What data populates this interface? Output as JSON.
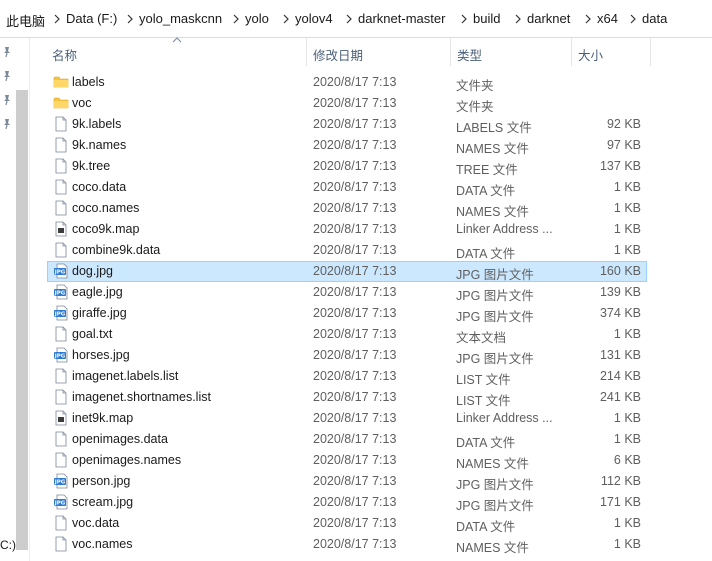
{
  "breadcrumb": [
    "此电脑",
    "Data (F:)",
    "yolo_maskcnn",
    "yolo",
    "yolov4",
    "darknet-master",
    "build",
    "darknet",
    "x64",
    "data"
  ],
  "nav": {
    "edge_label": "C:)"
  },
  "columns": {
    "name": "名称",
    "date": "修改日期",
    "type": "类型",
    "size": "大小"
  },
  "files": [
    {
      "name": "labels",
      "date": "2020/8/17 7:13",
      "type": "文件夹",
      "size": "",
      "icon": "folder-icon"
    },
    {
      "name": "voc",
      "date": "2020/8/17 7:13",
      "type": "文件夹",
      "size": "",
      "icon": "folder-icon"
    },
    {
      "name": "9k.labels",
      "date": "2020/8/17 7:13",
      "type": "LABELS 文件",
      "size": "92 KB",
      "icon": "file-icon"
    },
    {
      "name": "9k.names",
      "date": "2020/8/17 7:13",
      "type": "NAMES 文件",
      "size": "97 KB",
      "icon": "file-icon"
    },
    {
      "name": "9k.tree",
      "date": "2020/8/17 7:13",
      "type": "TREE 文件",
      "size": "137 KB",
      "icon": "file-icon"
    },
    {
      "name": "coco.data",
      "date": "2020/8/17 7:13",
      "type": "DATA 文件",
      "size": "1 KB",
      "icon": "file-icon"
    },
    {
      "name": "coco.names",
      "date": "2020/8/17 7:13",
      "type": "NAMES 文件",
      "size": "1 KB",
      "icon": "file-icon"
    },
    {
      "name": "coco9k.map",
      "date": "2020/8/17 7:13",
      "type": "Linker Address ...",
      "size": "1 KB",
      "icon": "map-file-icon"
    },
    {
      "name": "combine9k.data",
      "date": "2020/8/17 7:13",
      "type": "DATA 文件",
      "size": "1 KB",
      "icon": "file-icon"
    },
    {
      "name": "dog.jpg",
      "date": "2020/8/17 7:13",
      "type": "JPG 图片文件",
      "size": "160 KB",
      "icon": "jpg-file-icon",
      "selected": true
    },
    {
      "name": "eagle.jpg",
      "date": "2020/8/17 7:13",
      "type": "JPG 图片文件",
      "size": "139 KB",
      "icon": "jpg-file-icon"
    },
    {
      "name": "giraffe.jpg",
      "date": "2020/8/17 7:13",
      "type": "JPG 图片文件",
      "size": "374 KB",
      "icon": "jpg-file-icon"
    },
    {
      "name": "goal.txt",
      "date": "2020/8/17 7:13",
      "type": "文本文档",
      "size": "1 KB",
      "icon": "file-icon"
    },
    {
      "name": "horses.jpg",
      "date": "2020/8/17 7:13",
      "type": "JPG 图片文件",
      "size": "131 KB",
      "icon": "jpg-file-icon"
    },
    {
      "name": "imagenet.labels.list",
      "date": "2020/8/17 7:13",
      "type": "LIST 文件",
      "size": "214 KB",
      "icon": "file-icon"
    },
    {
      "name": "imagenet.shortnames.list",
      "date": "2020/8/17 7:13",
      "type": "LIST 文件",
      "size": "241 KB",
      "icon": "file-icon"
    },
    {
      "name": "inet9k.map",
      "date": "2020/8/17 7:13",
      "type": "Linker Address ...",
      "size": "1 KB",
      "icon": "map-file-icon"
    },
    {
      "name": "openimages.data",
      "date": "2020/8/17 7:13",
      "type": "DATA 文件",
      "size": "1 KB",
      "icon": "file-icon"
    },
    {
      "name": "openimages.names",
      "date": "2020/8/17 7:13",
      "type": "NAMES 文件",
      "size": "6 KB",
      "icon": "file-icon"
    },
    {
      "name": "person.jpg",
      "date": "2020/8/17 7:13",
      "type": "JPG 图片文件",
      "size": "112 KB",
      "icon": "jpg-file-icon"
    },
    {
      "name": "scream.jpg",
      "date": "2020/8/17 7:13",
      "type": "JPG 图片文件",
      "size": "171 KB",
      "icon": "jpg-file-icon"
    },
    {
      "name": "voc.data",
      "date": "2020/8/17 7:13",
      "type": "DATA 文件",
      "size": "1 KB",
      "icon": "file-icon"
    },
    {
      "name": "voc.names",
      "date": "2020/8/17 7:13",
      "type": "NAMES 文件",
      "size": "1 KB",
      "icon": "file-icon"
    }
  ],
  "colors": {
    "selection_bg": "#cce8ff",
    "selection_border": "#99d1ff",
    "folder": "#f6c343",
    "jpg_badge": "#2b79d0",
    "header_text": "#4c607a"
  }
}
